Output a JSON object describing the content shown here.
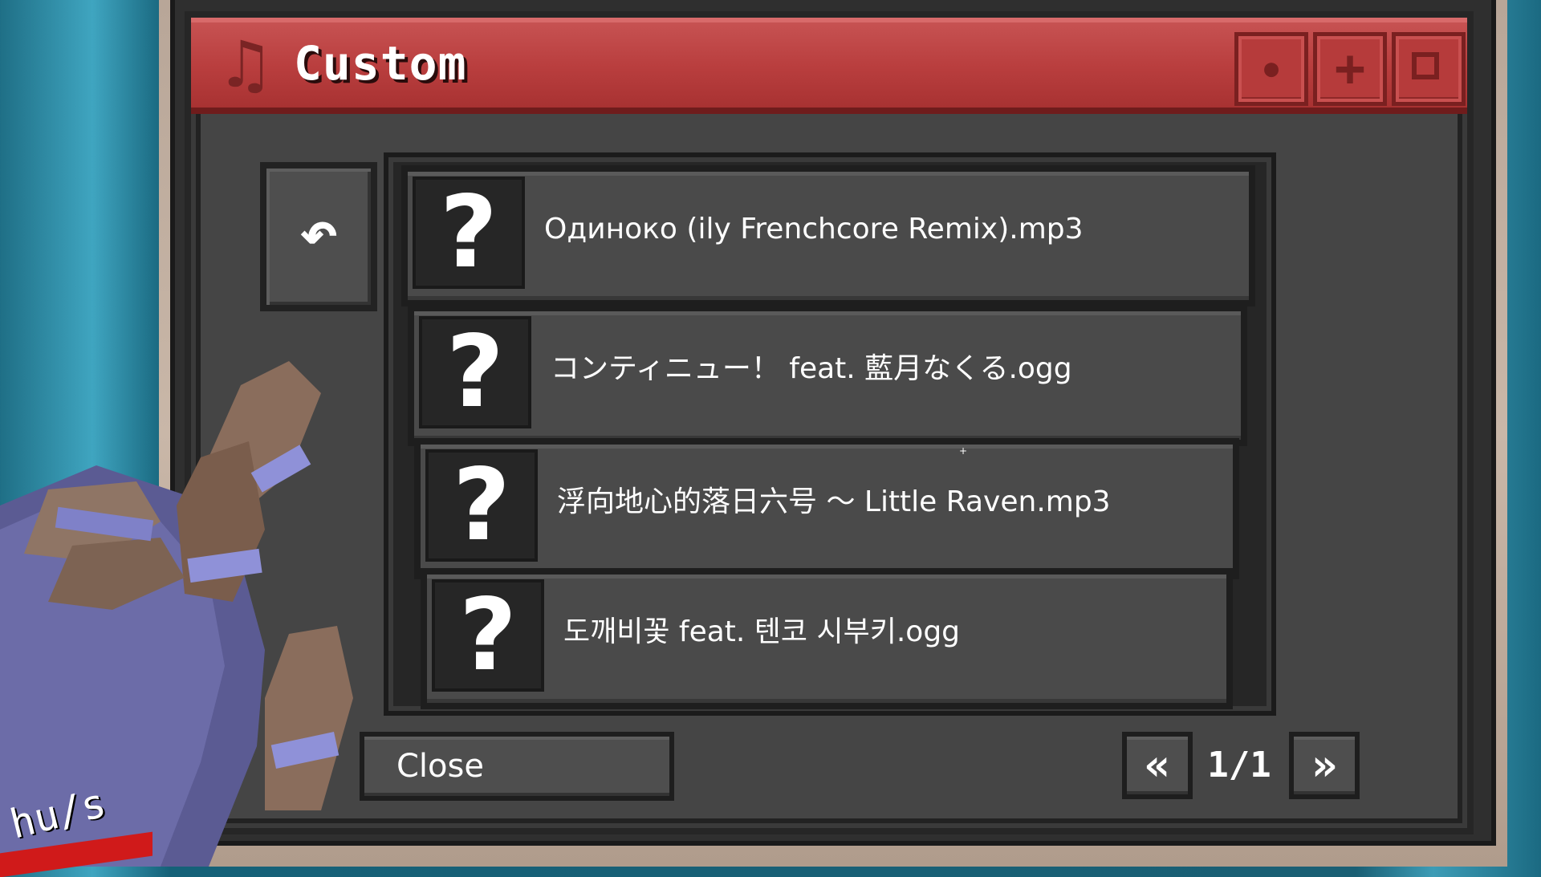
{
  "window": {
    "title": "Custom",
    "title_icon": "music-note-icon",
    "controls": {
      "minimize_icon": "dot-icon",
      "add_icon": "plus-icon",
      "maximize_icon": "square-icon"
    }
  },
  "back_button": {
    "icon": "undo-arrow-icon",
    "glyph": "↶"
  },
  "tracks": [
    {
      "thumbnail": "?",
      "name": "Одиноко (ily Frenchcore Remix).mp3"
    },
    {
      "thumbnail": "?",
      "name": "コンティニュー！ feat. 藍月なくる.ogg"
    },
    {
      "thumbnail": "?",
      "name": "浮向地心的落日六号 ～ Little Raven.mp3"
    },
    {
      "thumbnail": "?",
      "name": "도깨비꽃 feat. 텐코 시부키.ogg"
    }
  ],
  "footer": {
    "close_label": "Close",
    "prev_glyph": "«",
    "next_glyph": "»",
    "page_indicator": "1/1"
  },
  "hud": {
    "speed_unit": "hu/s"
  },
  "colors": {
    "titlebar": "#b93e3e",
    "panel": "#454545",
    "row": "#4a4a4a",
    "text": "#ffffff",
    "background": "#1f6f86"
  }
}
